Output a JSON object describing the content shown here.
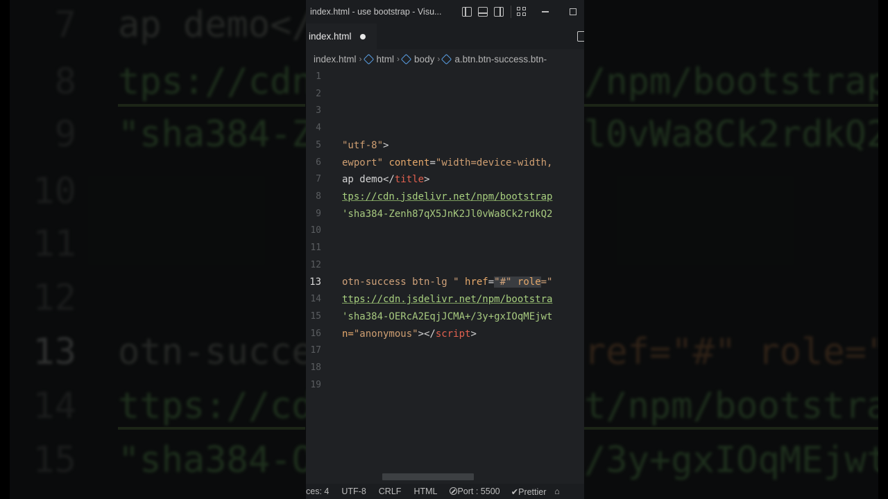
{
  "window": {
    "title": "index.html - use bootstrap - Visu..."
  },
  "tabs": [
    {
      "label": "index.html",
      "modified": true
    }
  ],
  "breadcrumb": {
    "file": "index.html",
    "items": [
      "html",
      "body",
      "a.btn.btn-success.btn-"
    ]
  },
  "editor": {
    "active_line": "13",
    "line_numbers": [
      "1",
      "2",
      "3",
      "4",
      "5",
      "6",
      "7",
      "8",
      "9",
      "10",
      "11",
      "12",
      "13",
      "14",
      "15",
      "16",
      "17",
      "18",
      "19"
    ],
    "code": {
      "l5a": "\"utf-8\"",
      "l5b": ">",
      "l6a": "ewport\"",
      "l6b": "content",
      "l6c": "=",
      "l6d": "\"width=device-width,",
      "l7a": "ap demo</",
      "l7b": "title",
      "l7c": ">",
      "l8": "tps://cdn.jsdelivr.net/npm/bootstrap",
      "l9": "'sha384-Zenh87qX5JnK2Jl0vWa8Ck2rdkQ2",
      "l13a": "otn-success btn-lg \"",
      "l13b": "href",
      "l13c": "=",
      "l13d": "\"#\"",
      "l13e": "role",
      "l13f": "=\"",
      "l14": "ttps://cdn.jsdelivr.net/npm/bootstra",
      "l15": "'sha384-OERcA2EqjJCMA+/3y+gxIOqMEjwt",
      "l16a": "n=",
      "l16b": "\"anonymous\"",
      "l16c": "></",
      "l16d": "script",
      "l16e": ">"
    }
  },
  "statusbar": {
    "spaces": "ces: 4",
    "encoding": "UTF-8",
    "eol": "CRLF",
    "language": "HTML",
    "port": "Port : 5500",
    "formatter": "Prettier"
  },
  "background": {
    "lines": [
      {
        "num": "7",
        "text": "ap demo</"
      },
      {
        "num": "8",
        "text": "tps://cdn"
      },
      {
        "num": "9",
        "text": "\"sha384-Z"
      },
      {
        "num": "10",
        "text": ""
      },
      {
        "num": "11",
        "text": ""
      },
      {
        "num": "12",
        "text": ""
      },
      {
        "num": "13",
        "text": "otn-succe"
      },
      {
        "num": "14",
        "text": "ttps://cd"
      },
      {
        "num": "15",
        "text": "\"sha384-O"
      }
    ],
    "right": [
      "",
      "/npm/bootstrap",
      "l0vWa8Ck2rdkQ2",
      "",
      "",
      "",
      "ref=\"#\" role=\"",
      "t/npm/bootstrap",
      "/3y+gxIOqMEjwt"
    ]
  },
  "colors": {
    "editor_bg": "#1f2124",
    "string": "#a8d07f",
    "tag": "#e2614f",
    "attribute": "#e5a86b"
  }
}
